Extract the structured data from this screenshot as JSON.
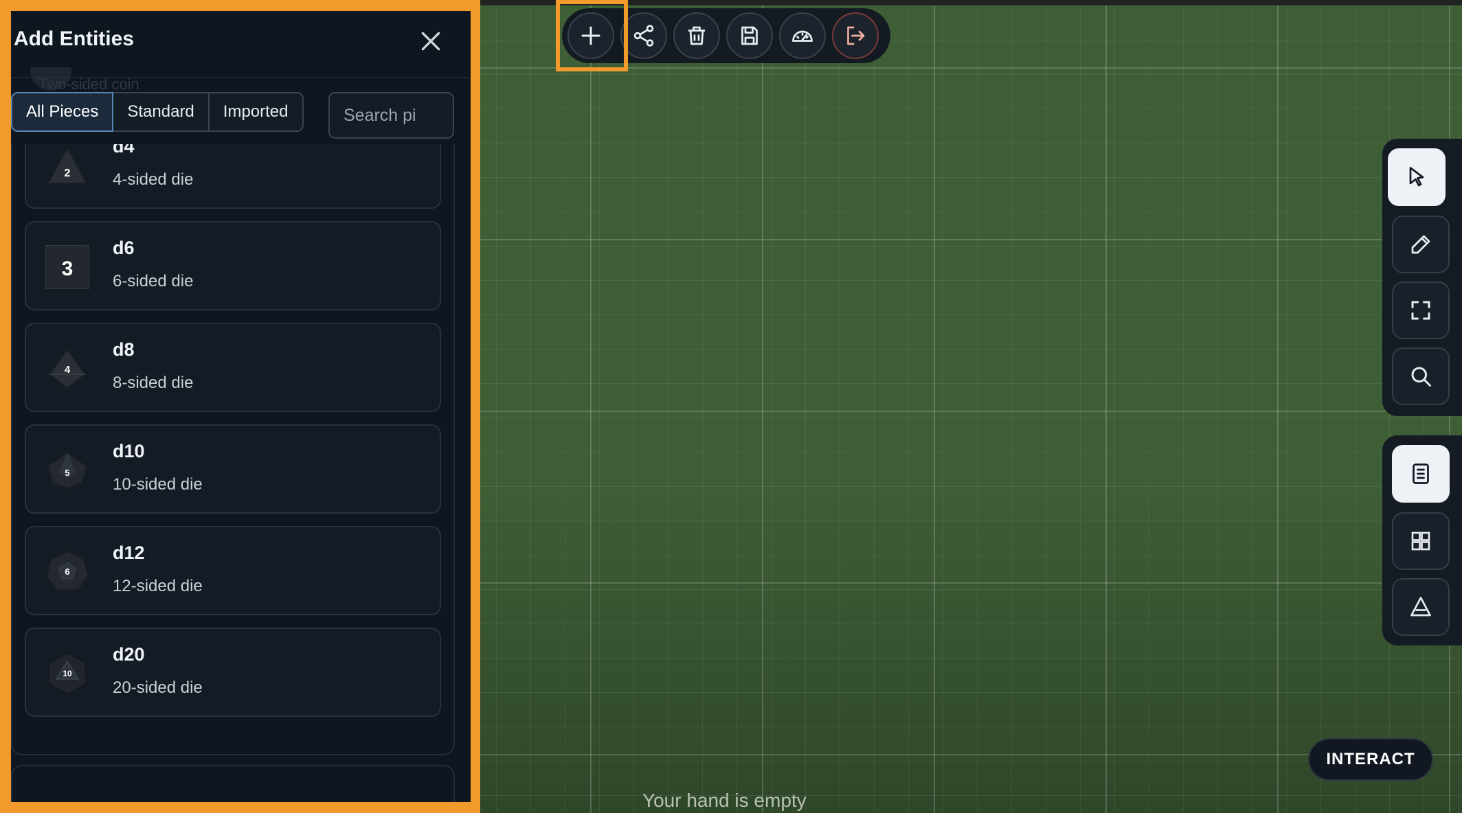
{
  "panel": {
    "title": "Add Entities",
    "ghost_item": "Two-sided coin",
    "filters": [
      "All Pieces",
      "Standard",
      "Imported"
    ],
    "active_filter": "All Pieces",
    "search_placeholder": "Search pi",
    "items": [
      {
        "name": "d4",
        "desc": "4-sided die",
        "face": "2"
      },
      {
        "name": "d6",
        "desc": "6-sided die",
        "face": "3"
      },
      {
        "name": "d8",
        "desc": "8-sided die",
        "face": "4"
      },
      {
        "name": "d10",
        "desc": "10-sided die",
        "face": "5"
      },
      {
        "name": "d12",
        "desc": "12-sided die",
        "face": "6"
      },
      {
        "name": "d20",
        "desc": "20-sided die",
        "face": "10"
      }
    ]
  },
  "toolbar": {
    "buttons": [
      "plus-icon",
      "share-icon",
      "trash-icon",
      "save-icon",
      "gauge-icon",
      "exit-icon"
    ]
  },
  "right_tools": {
    "top": [
      "pointer-icon",
      "pencil-icon",
      "fullscreen-icon",
      "search-icon"
    ],
    "bottom": [
      "document-icon",
      "grid-icon",
      "triangle-icon"
    ]
  },
  "board": {
    "hand_text": "Your hand is empty",
    "interact_label": "INTERACT"
  },
  "colors": {
    "board": "#3e5e36",
    "highlight": "#f39a2c",
    "panel_bg": "#0f1620"
  }
}
